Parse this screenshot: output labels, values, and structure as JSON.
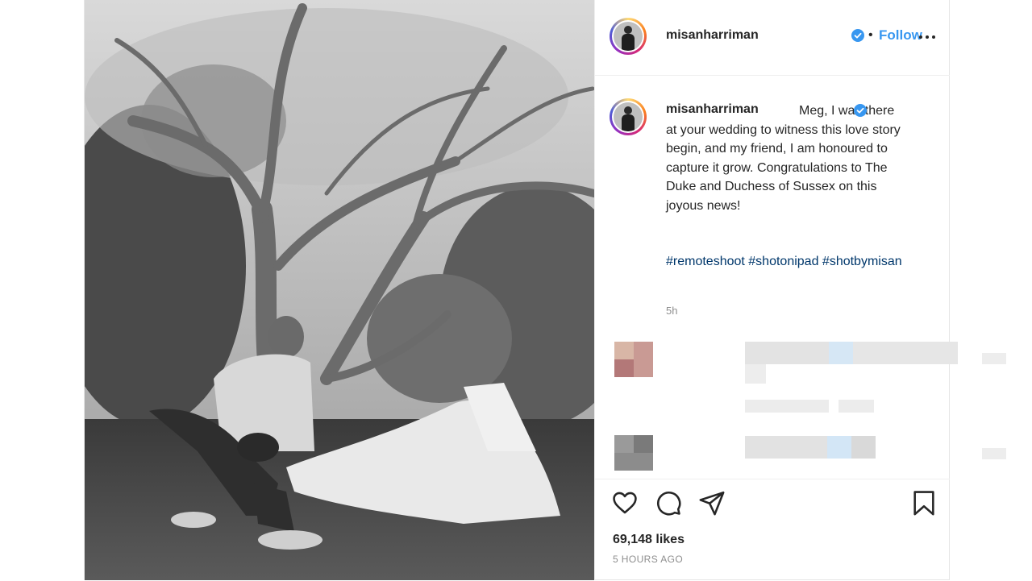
{
  "post": {
    "username": "misanharriman",
    "follow_label": "Follow",
    "dot": "•",
    "caption": {
      "text": "Meg, I was there at your wedding to witness this love story begin, and my friend, I am honoured to capture it grow. Congratulations to The Duke and Duchess of Sussex on this joyous news!",
      "hashtags": "#remoteshoot #shotonipad #shotbymisan",
      "age": "5h"
    },
    "likes": "69,148 likes",
    "time_ago": "5 HOURS AGO"
  },
  "icons": {
    "verified": "verified-badge-icon",
    "more": "more-options-icon",
    "like": "heart-icon",
    "comment": "comment-bubble-icon",
    "share": "paper-plane-icon",
    "save": "bookmark-icon"
  },
  "colors": {
    "link": "#3897f0",
    "hashtag": "#00376b",
    "muted": "#8e8e8e",
    "text": "#262626"
  }
}
